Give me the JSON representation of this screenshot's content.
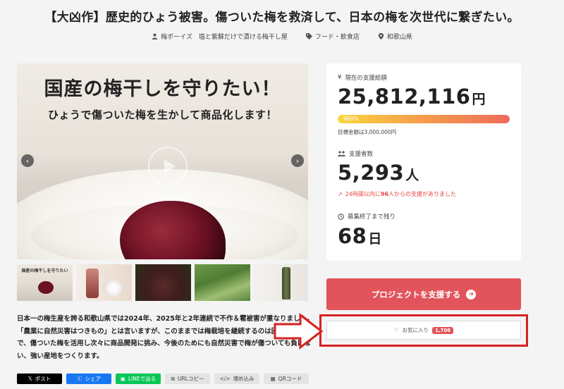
{
  "project": {
    "title": "【大凶作】歴史的ひょう被害。傷ついた梅を救済して、日本の梅を次世代に繋ぎたい。",
    "owner": "梅ボーイズ　塩と紫蘇だけで漬ける梅干し屋",
    "category": "フード・飲食店",
    "location": "和歌山県"
  },
  "hero": {
    "headline": "国産の梅干しを守りたい！",
    "subline": "ひょうで傷ついた梅を生かして商品化します！",
    "thumbnail_caption": "国産の梅干しを守りたい"
  },
  "stats": {
    "raised_label": "現在の支援総額",
    "raised_amount": "25,812,116",
    "raised_unit": "円",
    "progress_label": "860%",
    "progress_fraction": 1.0,
    "goal_text": "目標金額は3,000,000円",
    "supporters_label": "支援者数",
    "supporters_count": "5,293",
    "supporters_unit": "人",
    "trend_prefix": "24時間以内に",
    "trend_number": "96",
    "trend_suffix": "人からの支援がありました",
    "remaining_label": "募集終了まで残り",
    "remaining_days": "68",
    "remaining_unit": "日"
  },
  "actions": {
    "support_label": "プロジェクトを支援する",
    "favorite_label": "お気に入り",
    "favorite_count": "1,706"
  },
  "description": "日本一の梅生産を誇る和歌山県では2024年、2025年と2年連続で不作＆雹被害が重なりました。「農業に自然災害はつきもの」とは言いますが、このままでは梅栽培を継続するのは困難です。そこで、傷ついた梅を活用し次々に商品開発に挑み、今後のためにも自然災害で梅が傷ついても負けない、強い産地をつくります。",
  "share": {
    "x_label": "ポスト",
    "facebook_label": "シェア",
    "line_label": "LINEで送る",
    "copy_label": "URLコピー",
    "embed_label": "埋め込み",
    "qr_label": "QRコード"
  },
  "colors": {
    "accent": "#e2545b",
    "highlight_box": "#d62222",
    "trend": "#e8443a"
  },
  "icons": [
    "user-icon",
    "tag-icon",
    "location-pin-icon",
    "yen-icon",
    "supporters-icon",
    "trend-up-icon",
    "clock-icon",
    "heart-icon",
    "arrow-right-icon",
    "play-icon",
    "chevron-left-icon",
    "chevron-right-icon"
  ]
}
